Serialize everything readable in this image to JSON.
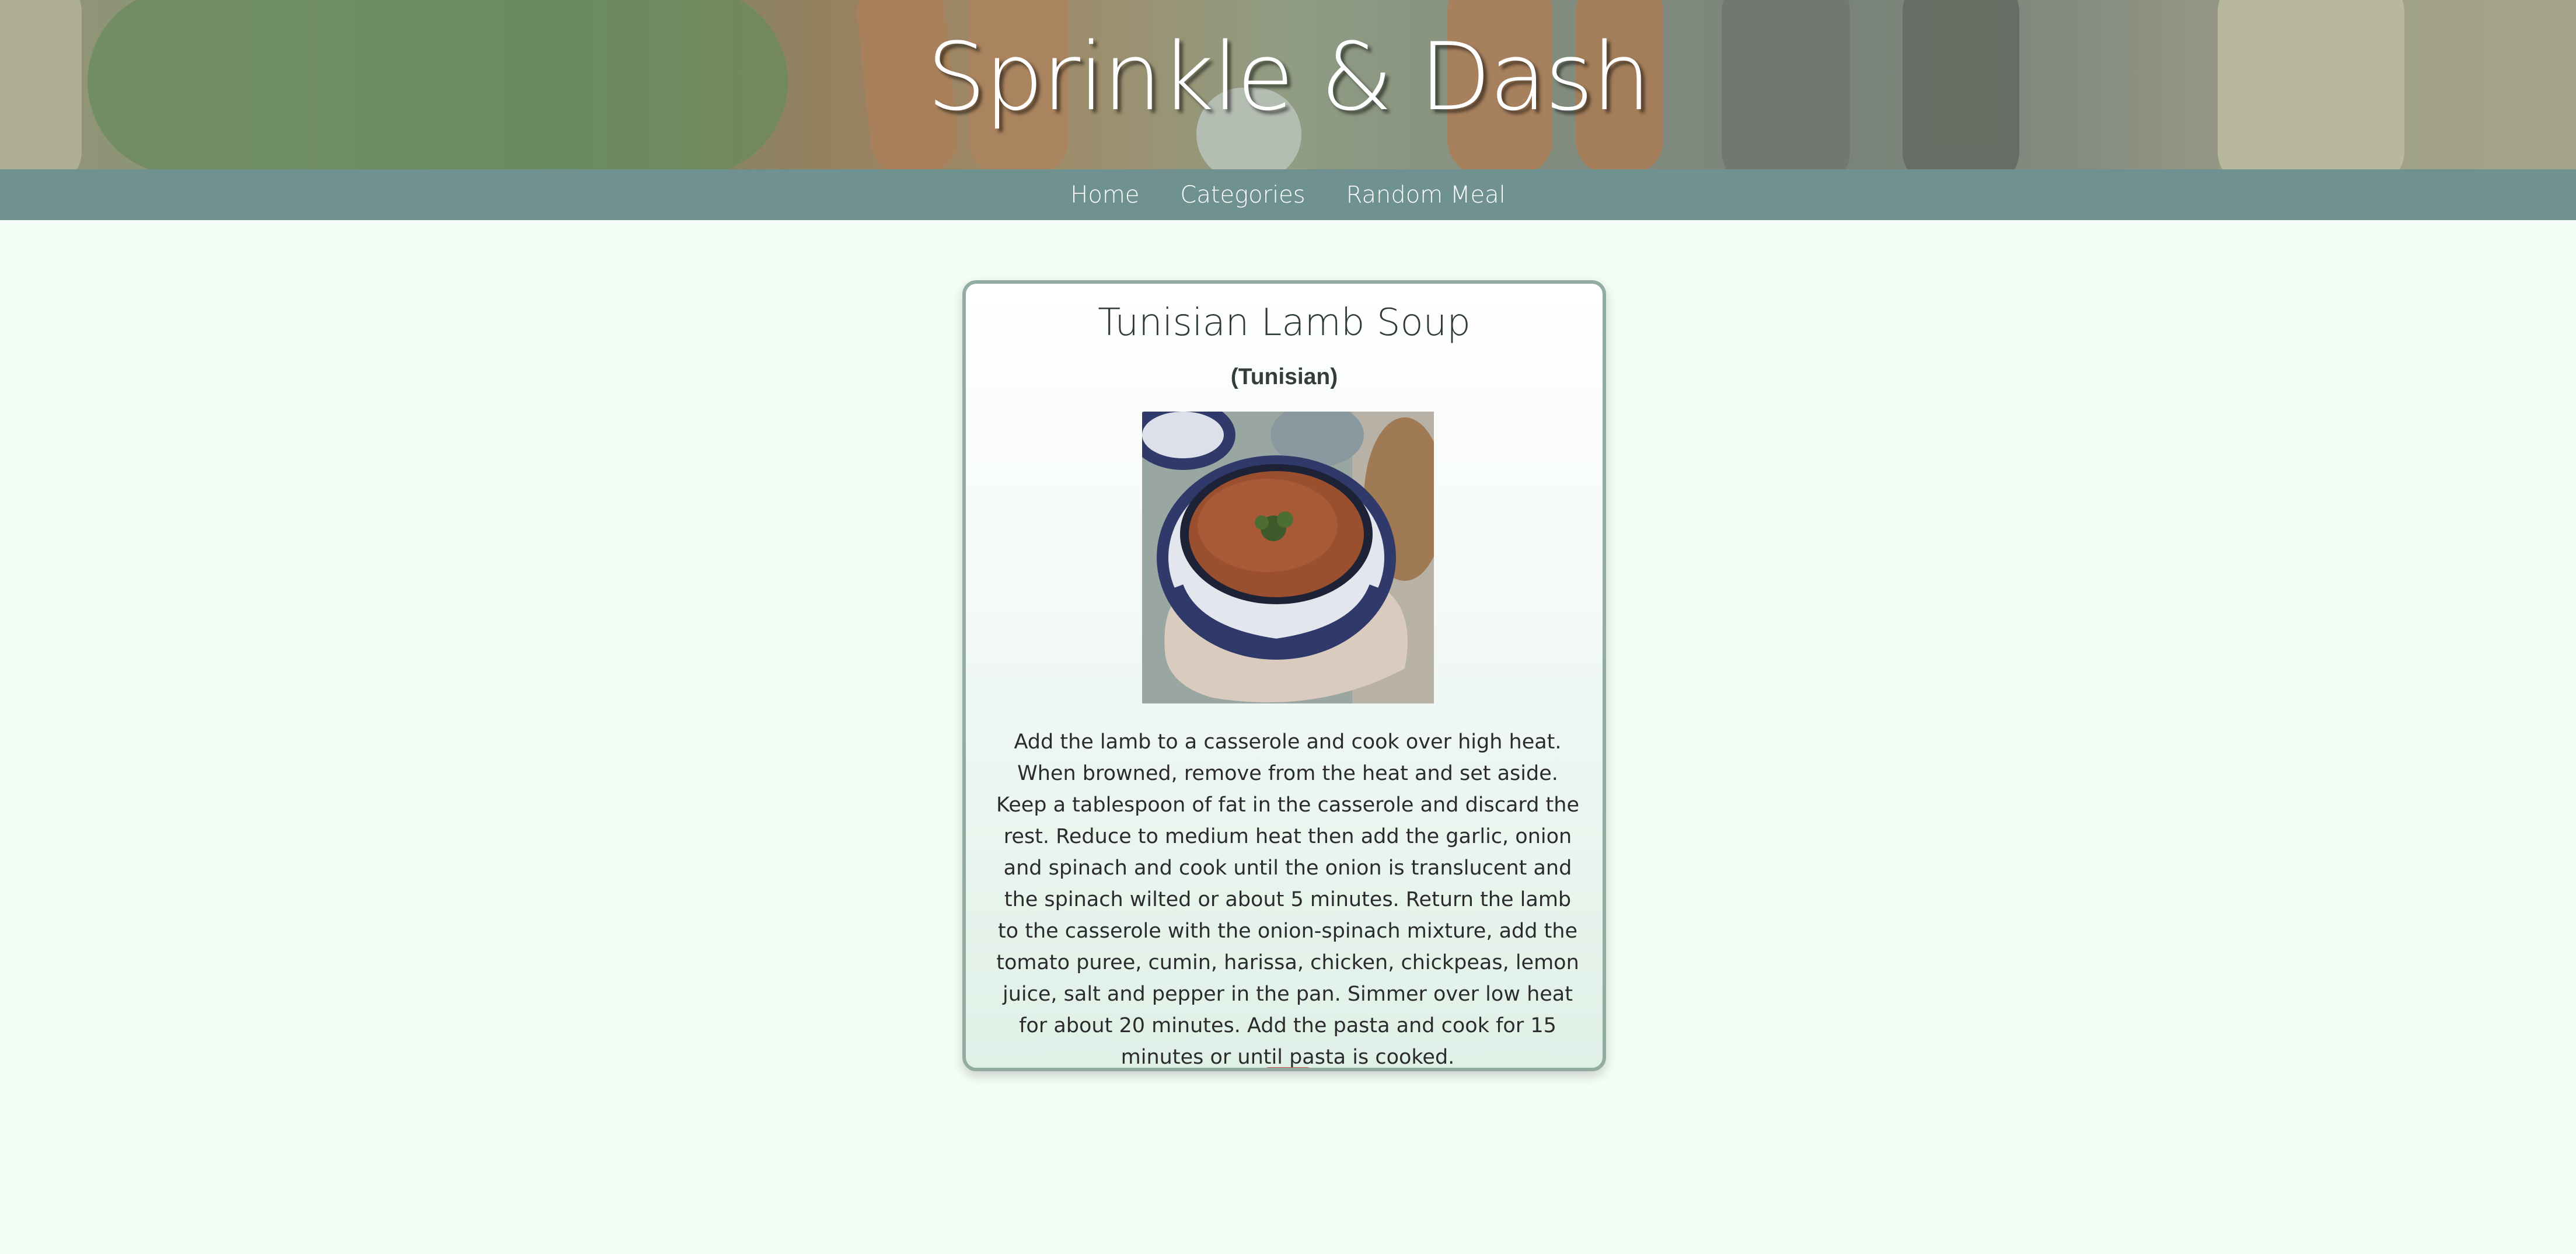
{
  "site": {
    "title": "Sprinkle & Dash"
  },
  "nav": {
    "items": [
      {
        "label": "Home"
      },
      {
        "label": "Categories"
      },
      {
        "label": "Random Meal"
      }
    ]
  },
  "meal": {
    "title": "Tunisian Lamb Soup",
    "area": "(Tunisian)",
    "instructions": "Add the lamb to a casserole and cook over high heat. When browned, remove from the heat and set aside. Keep a tablespoon of fat in the casserole and discard the rest. Reduce to medium heat then add the garlic, onion and spinach and cook until the onion is translucent and the spinach wilted or about 5 minutes. Return the lamb to the casserole with the onion-spinach mixture, add the tomato puree, cumin, harissa, chicken, chickpeas, lemon juice, salt and pepper in the pan. Simmer over low heat for about 20 minutes. Add the pasta and cook for 15 minutes or until pasta is cooked."
  },
  "colors": {
    "nav_background": "#6f918f",
    "page_background": "#f5fdf7",
    "card_border": "#93aca1",
    "button_accent": "#d2543f"
  }
}
